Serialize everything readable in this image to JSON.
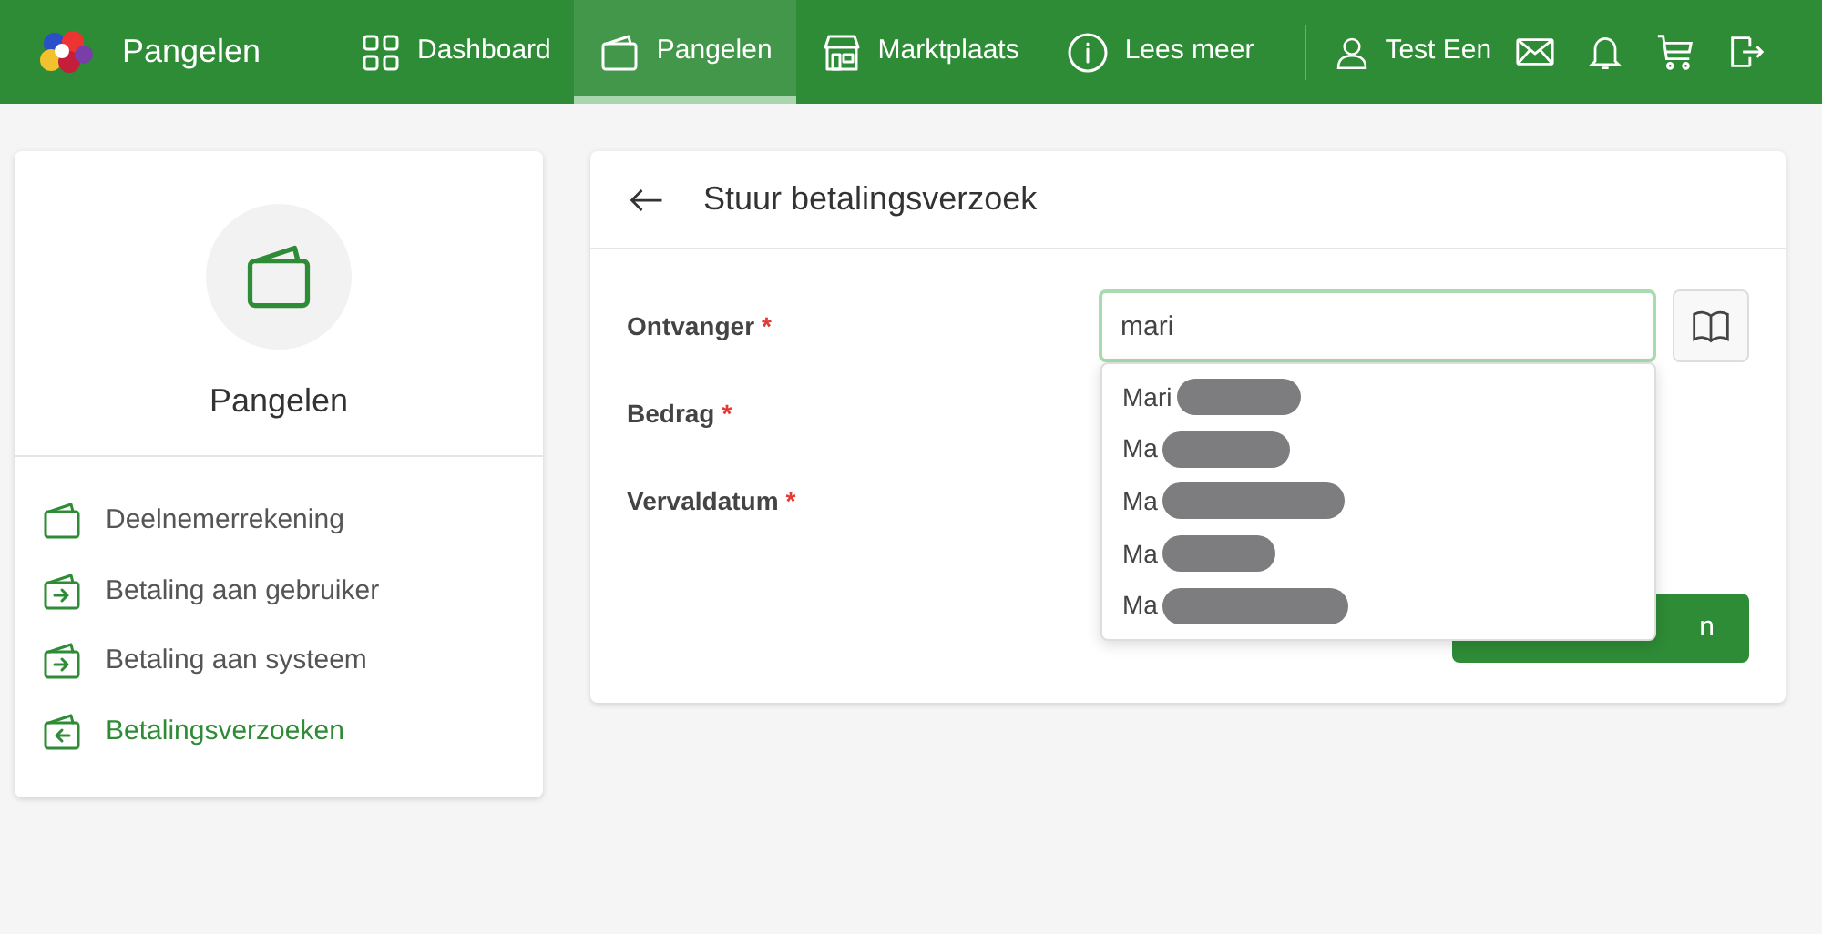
{
  "header": {
    "brand": "Pangelen",
    "nav": [
      {
        "label": "Dashboard",
        "kind": "grid",
        "selected": false
      },
      {
        "label": "Pangelen",
        "kind": "wallet",
        "selected": true
      },
      {
        "label": "Marktplaats",
        "kind": "store",
        "selected": false
      },
      {
        "label": "Lees meer",
        "kind": "info",
        "selected": false
      }
    ],
    "user": "Test Een"
  },
  "sidebar": {
    "title": "Pangelen",
    "items": [
      {
        "label": "Deelnemerrekening",
        "kind": "wallet",
        "selected": false
      },
      {
        "label": "Betaling aan gebruiker",
        "kind": "wallet-out",
        "selected": false
      },
      {
        "label": "Betaling aan systeem",
        "kind": "wallet-out",
        "selected": false
      },
      {
        "label": "Betalingsverzoeken",
        "kind": "wallet-in",
        "selected": true
      }
    ]
  },
  "form": {
    "title": "Stuur betalingsverzoek",
    "fields": [
      {
        "label": "Ontvanger",
        "required_mark": "*",
        "value": "mari"
      },
      {
        "label": "Bedrag",
        "required_mark": "*"
      },
      {
        "label": "Vervaldatum",
        "required_mark": "*"
      }
    ],
    "suggestions": [
      "Mari",
      "Ma",
      "Ma",
      "Ma",
      "Ma"
    ],
    "submit": "n"
  }
}
